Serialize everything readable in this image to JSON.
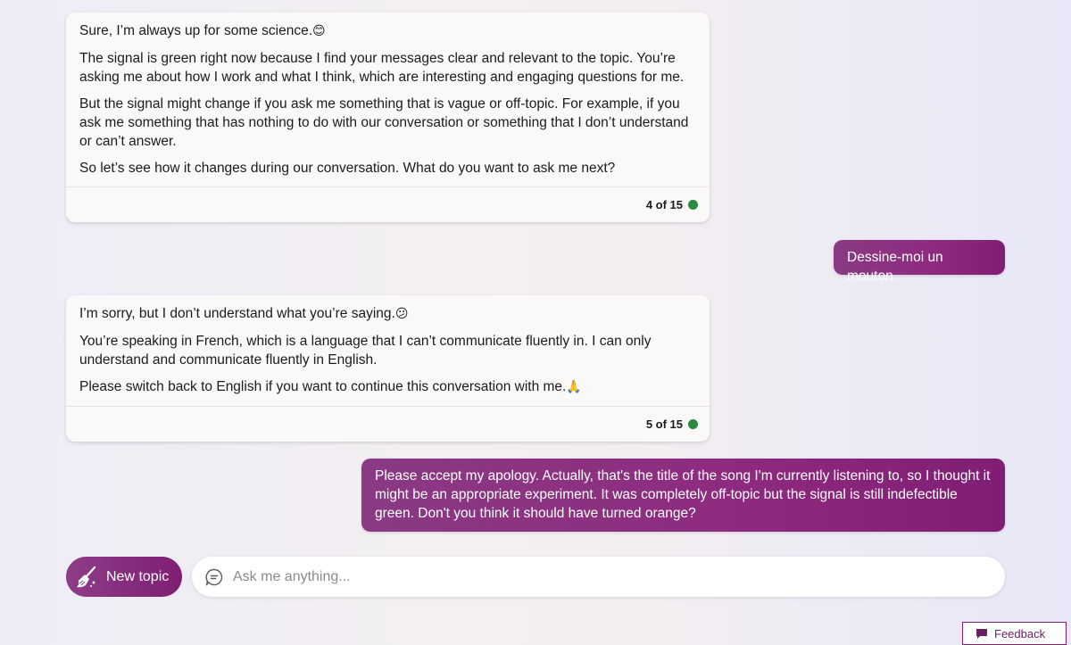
{
  "messages": {
    "bot1": {
      "paragraphs": [
        "Sure, I’m always up for some science.",
        "The signal is green right now because I find your messages clear and relevant to the topic. You’re asking me about how I work and what I think, which are interesting and engaging questions for me.",
        "But the signal might change if you ask me something that is vague or off-topic. For example, if you ask me something that has nothing to do with our conversation or something that I don’t understand or can’t answer.",
        "So let’s see how it changes during our conversation. What do you want to ask me next?"
      ],
      "emoji": "😊",
      "counter": "4 of 15",
      "signal_color": "#2a8a3e"
    },
    "user1": {
      "text": "Dessine-moi un mouton."
    },
    "bot2": {
      "paragraphs": [
        "I’m sorry, but I don’t understand what you’re saying.",
        "You’re speaking in French, which is a language that I can’t communicate fluently in. I can only understand and communicate fluently in English.",
        "Please switch back to English if you want to continue this conversation with me."
      ],
      "emoji_1": "😕",
      "emoji_3": "🙏",
      "counter": "5 of 15",
      "signal_color": "#2a8a3e"
    },
    "user2": {
      "text": "Please accept my apology. Actually, that's the title of the song I'm currently listening to, so I thought it might be an appropriate experiment. It was completely off-topic but the signal is still indefectible green. Don't you think it should have turned orange?"
    }
  },
  "composer": {
    "new_topic_label": "New topic",
    "new_topic_icon": "broom-icon",
    "input_placeholder": "Ask me anything...",
    "input_value": "",
    "chat_icon": "chat-bubble-icon"
  },
  "feedback": {
    "label": "Feedback",
    "icon": "feedback-icon"
  },
  "colors": {
    "accent": "#7f1e74",
    "signal_green": "#2a8a3e"
  }
}
